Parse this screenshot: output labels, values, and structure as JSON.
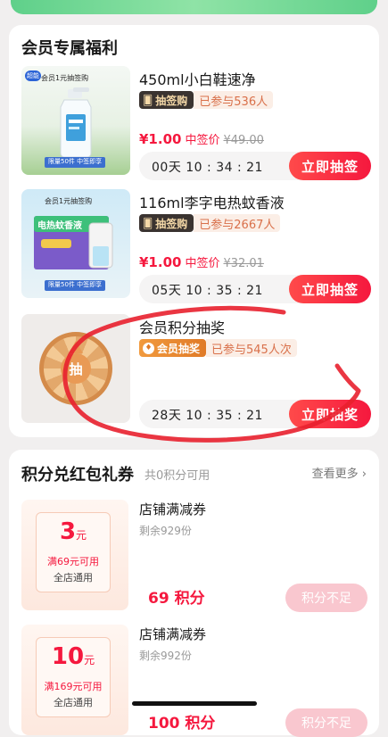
{
  "member_section": {
    "title": "会员专属福利",
    "items": [
      {
        "title": "450ml小白鞋速净",
        "tag": "抽签购",
        "joined": "已参与536人",
        "price": "¥1.00",
        "price_label": "中签价",
        "original_price": "¥49.00",
        "timer": "00天  10 : 34 : 21",
        "button": "立即抽签",
        "thumb_promo": "会员1元抽签购",
        "thumb_badge": "超能",
        "thumb_tag": "限量50件  中签即享"
      },
      {
        "title": "116ml李字电热蚊香液",
        "tag": "抽签购",
        "joined": "已参与2667人",
        "price": "¥1.00",
        "price_label": "中签价",
        "original_price": "¥32.01",
        "timer": "05天  10 : 35 : 21",
        "button": "立即抽签",
        "thumb_promo": "会员1元抽签购",
        "thumb_box": "电热蚊香液",
        "thumb_tag": "限量50件  中签即享"
      },
      {
        "title": "会员积分抽奖",
        "tag": "会员抽奖",
        "joined": "已参与545人次",
        "timer": "28天  10 : 35 : 21",
        "button": "立即抽奖",
        "wheel_center": "抽"
      }
    ]
  },
  "points_section": {
    "title": "积分兑红包礼券",
    "points_available": "共0积分可用",
    "see_more": "查看更多 ›",
    "coupons": [
      {
        "amount": "3",
        "unit": "元",
        "condition": "满69元可用",
        "scope": "全店通用",
        "title": "店铺满减券",
        "remaining": "剩余929份",
        "points": "69 积分",
        "button": "积分不足"
      },
      {
        "amount": "10",
        "unit": "元",
        "condition": "满169元可用",
        "scope": "全店通用",
        "title": "店铺满减券",
        "remaining": "剩余992份",
        "points": "100 积分",
        "button": "积分不足"
      }
    ]
  },
  "colors": {
    "accent_red": "#f5183e",
    "tag_dark": "#3a3330",
    "member_orange": "#e07a27",
    "disabled_pink": "#f9c7cf",
    "scribble_red": "#e8202e"
  }
}
